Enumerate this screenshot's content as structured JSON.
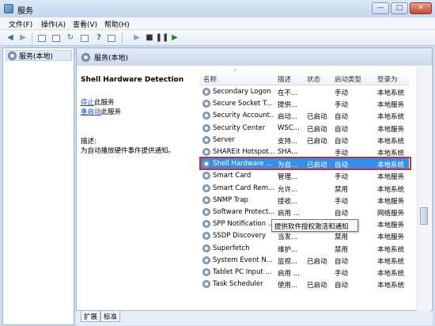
{
  "window": {
    "title": "服务"
  },
  "menu": [
    "文件(F)",
    "操作(A)",
    "查看(V)",
    "帮助(H)"
  ],
  "tree": {
    "root_label": "服务(本地)"
  },
  "panel": {
    "header": "服务(本地)",
    "service_name": "Shell Hardware Detection",
    "stop_link": "停止",
    "stop_suffix": "此服务",
    "restart_link": "重启动",
    "restart_suffix": "此服务",
    "desc_label": "描述:",
    "desc_text": "为自动播放硬件事件提供通知。"
  },
  "table": {
    "headers": {
      "name": "名称",
      "desc": "描述",
      "status": "状态",
      "startup": "启动类型",
      "logon": "登录为"
    },
    "rows": [
      {
        "name": "Secondary Logon",
        "desc": "在不...",
        "status": "",
        "startup": "手动",
        "logon": "本地系统"
      },
      {
        "name": "Secure Socket T...",
        "desc": "提供...",
        "status": "",
        "startup": "手动",
        "logon": "本地服务"
      },
      {
        "name": "Security Account...",
        "desc": "启动...",
        "status": "已启动",
        "startup": "自动",
        "logon": "本地系统"
      },
      {
        "name": "Security Center",
        "desc": "WSC...",
        "status": "已启动",
        "startup": "自动",
        "logon": "本地服务"
      },
      {
        "name": "Server",
        "desc": "支持...",
        "status": "已启动",
        "startup": "自动",
        "logon": "本地系统"
      },
      {
        "name": "SHAREit Hotspot...",
        "desc": "SHA...",
        "status": "",
        "startup": "手动",
        "logon": "本地系统"
      },
      {
        "name": "Shell Hardware ...",
        "desc": "为自...",
        "status": "已启动",
        "startup": "自动",
        "logon": "本地系统",
        "selected": true
      },
      {
        "name": "Smart Card",
        "desc": "管理...",
        "status": "",
        "startup": "手动",
        "logon": "本地服务"
      },
      {
        "name": "Smart Card Rem...",
        "desc": "允许...",
        "status": "",
        "startup": "禁用",
        "logon": "本地系统"
      },
      {
        "name": "SNMP Trap",
        "desc": "接收...",
        "status": "",
        "startup": "手动",
        "logon": "本地服务"
      },
      {
        "name": "Software Protect...",
        "desc": "启用 ...",
        "status": "",
        "startup": "自动",
        "logon": "网络服务"
      },
      {
        "name": "SPP Notification ...",
        "desc": "提供...",
        "status": "",
        "startup": "手动",
        "logon": "本地服务"
      },
      {
        "name": "SSDP Discovery",
        "desc": "当发...",
        "status": "",
        "startup": "禁用",
        "logon": "本地服务"
      },
      {
        "name": "Superfetch",
        "desc": "维护...",
        "status": "",
        "startup": "禁用",
        "logon": "本地系统"
      },
      {
        "name": "System Event N...",
        "desc": "监视...",
        "status": "已启动",
        "startup": "自动",
        "logon": "本地系统"
      },
      {
        "name": "Tablet PC Input ...",
        "desc": "启用 ...",
        "status": "",
        "startup": "手动",
        "logon": "本地系统"
      },
      {
        "name": "Task Scheduler",
        "desc": "使用...",
        "status": "已启动",
        "startup": "自动",
        "logon": "本地系统"
      }
    ]
  },
  "tooltip": "提供软件授权激活和通知",
  "tabs": [
    "扩展",
    "标准"
  ],
  "colors": {
    "selection": "#3390e6",
    "highlight_border": "#e0252b"
  }
}
